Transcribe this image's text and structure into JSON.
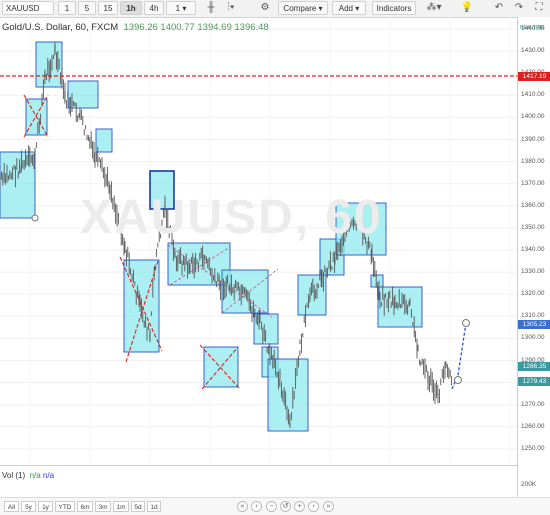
{
  "toolbar": {
    "symbol": "XAUUSD",
    "intervals": [
      "1",
      "5",
      "15",
      "1h",
      "4h",
      "1"
    ],
    "active_interval": "1h",
    "compare_label": "Compare",
    "add_label": "Add",
    "indicators_label": "Indicators"
  },
  "chart": {
    "title": "Gold/U.S. Dollar, 60, FXCM",
    "ohlc": "1396.26 1400.77 1394.69 1396.48",
    "watermark": "XAUUSD, 60",
    "realtime_tag": "REALTIME"
  },
  "price_axis": {
    "ticks": [
      "1440.00",
      "1430.00",
      "1420.00",
      "1410.00",
      "1400.00",
      "1390.00",
      "1380.00",
      "1370.00",
      "1360.00",
      "1350.00",
      "1340.00",
      "1330.00",
      "1320.00",
      "1310.00",
      "1300.00",
      "1290.00",
      "1280.00",
      "1270.00",
      "1260.00",
      "1250.00"
    ],
    "tag_red": "1417.19",
    "tag_blue": "1305.23",
    "tag_teal1": "1286.35",
    "tag_teal2": "1279.43"
  },
  "volume": {
    "label": "Vol (1)",
    "na1": "n/a",
    "na2": "n/a",
    "axis_label": "200K"
  },
  "bottom_bar": {
    "ranges": [
      "All",
      "5y",
      "1y",
      "YTD",
      "6m",
      "3m",
      "1m",
      "5d",
      "1d"
    ]
  },
  "colors": {
    "red_line": "#e02020",
    "blue_box": "#2a50c8",
    "teal_fill": "#8feaee",
    "candle": "#555555"
  }
}
